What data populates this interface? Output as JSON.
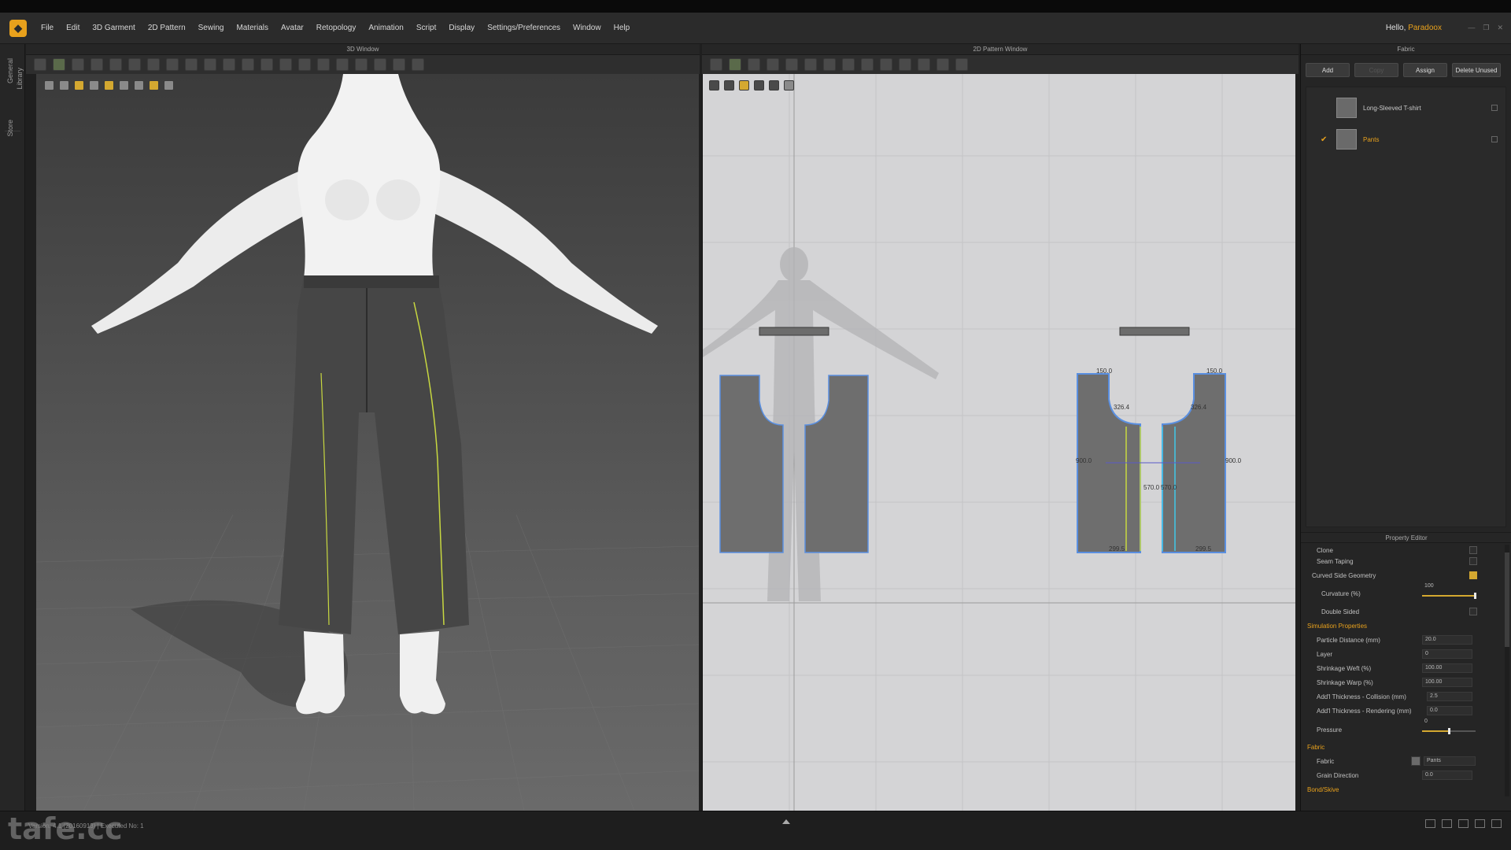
{
  "menu": {
    "items": [
      "File",
      "Edit",
      "3D Garment",
      "2D Pattern",
      "Sewing",
      "Materials",
      "Avatar",
      "Retopology",
      "Animation",
      "Script",
      "Display",
      "Settings/Preferences",
      "Window",
      "Help"
    ],
    "greeting": "Hello,",
    "user": "Paradoox"
  },
  "left_tabs": [
    "Library",
    "General",
    "Store"
  ],
  "windows": {
    "w3d_title": "3D Window",
    "w2d_title": "2D Pattern Window"
  },
  "pattern_dims": {
    "top_left": "150.0",
    "top_right": "150.0",
    "curve_left": "326.4",
    "curve_right": "326.4",
    "side_left": "900.0",
    "side_right": "900.0",
    "center_a": "570.0",
    "center_b": "570.0",
    "bottom_left": "299.5",
    "bottom_right": "299.5"
  },
  "fabric_panel": {
    "title": "Fabric",
    "buttons": {
      "add": "Add",
      "copy": "Copy",
      "assign": "Assign",
      "delete_unused": "Delete Unused"
    },
    "items": [
      {
        "name": "Long-Sleeved T-shirt",
        "selected": false
      },
      {
        "name": "Pants",
        "selected": true
      }
    ]
  },
  "property_editor": {
    "title": "Property Editor",
    "rows": {
      "clone": "Clone",
      "seam_taping": "Seam Taping",
      "curved_side_geometry": "Curved Side Geometry",
      "curvature_label": "Curvature (%)",
      "curvature_value": "100",
      "double_sided": "Double Sided",
      "simulation_properties": "Simulation Properties",
      "particle_distance_label": "Particle Distance (mm)",
      "particle_distance_value": "20.0",
      "layer_label": "Layer",
      "layer_value": "0",
      "shrinkage_weft_label": "Shrinkage Weft (%)",
      "shrinkage_weft_value": "100.00",
      "shrinkage_warp_label": "Shrinkage Warp (%)",
      "shrinkage_warp_value": "100.00",
      "add_thickness_collision_label": "Add'l Thickness - Collision (mm)",
      "add_thickness_collision_value": "2.5",
      "add_thickness_rendering_label": "Add'l Thickness - Rendering (mm)",
      "add_thickness_rendering_value": "0.0",
      "pressure_label": "Pressure",
      "pressure_value": "0",
      "fabric_section": "Fabric",
      "fabric_label": "Fabric",
      "fabric_value": "Pants",
      "grain_direction_label": "Grain Direction",
      "grain_direction_value": "0.0",
      "bond_skive": "Bond/Skive"
    }
  },
  "status": {
    "text": "Version: 4.1 (20160913) | Executed No: 1",
    "watermark": "tafe.cc"
  },
  "colors": {
    "accent": "#e8a11c",
    "pattern_outline": "#5a8fe0",
    "seam_yellow": "#c8d840",
    "seam_cyan": "#40c8e8"
  }
}
